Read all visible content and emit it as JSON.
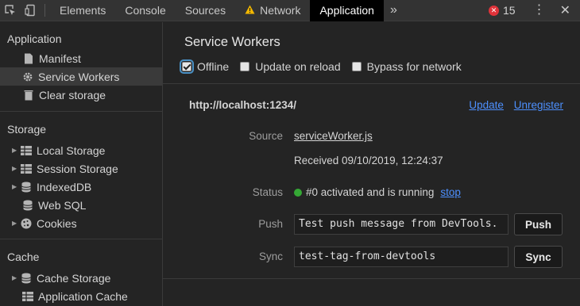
{
  "toolbar": {
    "tabs": [
      "Elements",
      "Console",
      "Sources",
      "Network",
      "Application"
    ],
    "more": "»",
    "error_count": "15",
    "error_badge": "✕"
  },
  "sidebar": {
    "application": {
      "title": "Application",
      "items": [
        "Manifest",
        "Service Workers",
        "Clear storage"
      ]
    },
    "storage": {
      "title": "Storage",
      "items": [
        "Local Storage",
        "Session Storage",
        "IndexedDB",
        "Web SQL",
        "Cookies"
      ]
    },
    "cache": {
      "title": "Cache",
      "items": [
        "Cache Storage",
        "Application Cache"
      ]
    }
  },
  "main": {
    "title": "Service Workers",
    "options": {
      "offline": "Offline",
      "update_on_reload": "Update on reload",
      "bypass": "Bypass for network",
      "offline_checked": true
    },
    "worker": {
      "host": "http://localhost:1234/",
      "update": "Update",
      "unregister": "Unregister",
      "source_label": "Source",
      "source_file": "serviceWorker.js",
      "received": "Received 09/10/2019, 12:24:37",
      "status_label": "Status",
      "status_text": "#0 activated and is running",
      "stop": "stop",
      "push_label": "Push",
      "push_value": "Test push message from DevTools.",
      "push_button": "Push",
      "sync_label": "Sync",
      "sync_value": "test-tag-from-devtools",
      "sync_button": "Sync"
    }
  },
  "colors": {
    "accent_link": "#4d90fe",
    "status_running": "#35a835",
    "error_badge": "#e0333a",
    "selected_bg": "#3a3a3a"
  }
}
